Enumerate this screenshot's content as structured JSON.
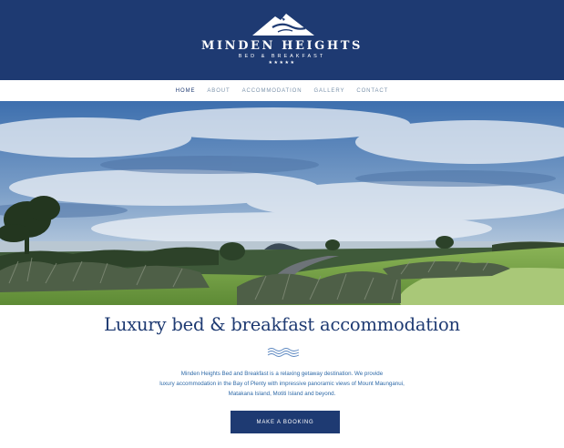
{
  "brand": {
    "name": "MINDEN HEIGHTS",
    "tagline": "BED & BREAKFAST",
    "stars": "★★★★★",
    "logo_icon": "mountain-logo-icon"
  },
  "nav": {
    "items": [
      {
        "label": "HOME",
        "active": true
      },
      {
        "label": "ABOUT"
      },
      {
        "label": "ACCOMMODATION"
      },
      {
        "label": "GALLERY"
      },
      {
        "label": "CONTACT"
      }
    ]
  },
  "hero": {
    "image": "panoramic landscape view"
  },
  "main": {
    "headline": "Luxury bed & breakfast accommodation",
    "divider_icon": "wave-divider-icon",
    "intro_lines": [
      "Minden Heights Bed and Breakfast is a relaxing getaway destination. We provide",
      "luxury accommodation in the Bay of Plenty with impressive panoramic views of Mount Maunganui,",
      "Matakana Island, Motiti Island and beyond."
    ],
    "cta_label": "MAKE A BOOKING"
  },
  "colors": {
    "navy": "#1e3a72",
    "nav_inactive": "#7d94ac",
    "body_text": "#2f6aa8",
    "background": "#ffffff"
  }
}
